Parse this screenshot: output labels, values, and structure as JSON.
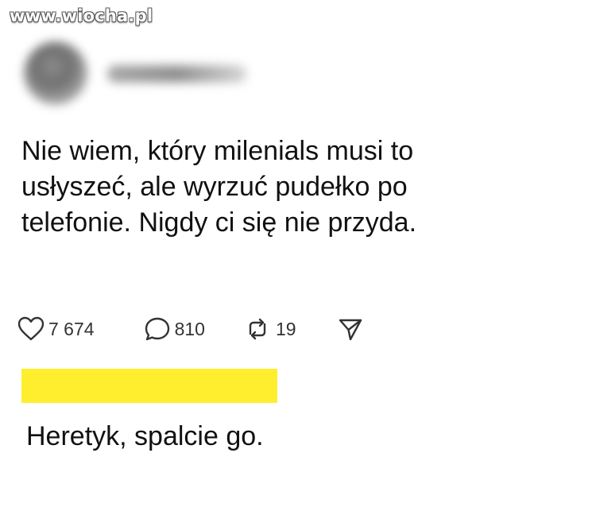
{
  "watermark": {
    "text": "www.wiocha.pl"
  },
  "post": {
    "text": "Nie wiem, który milenials musi to\nusłyszeć, ale wyrzuć pudełko po\ntelefonie. Nigdy ci się nie przyda."
  },
  "actions": {
    "likes": {
      "icon": "heart-icon",
      "count": "7 674"
    },
    "replies": {
      "icon": "comment-bubble-icon",
      "count": "810"
    },
    "reposts": {
      "icon": "repost-arrows-icon",
      "count": "19"
    },
    "share": {
      "icon": "send-paper-plane-icon"
    }
  },
  "reply": {
    "highlight_color": "#ffee2e",
    "text": "Heretyk, spalcie go."
  }
}
